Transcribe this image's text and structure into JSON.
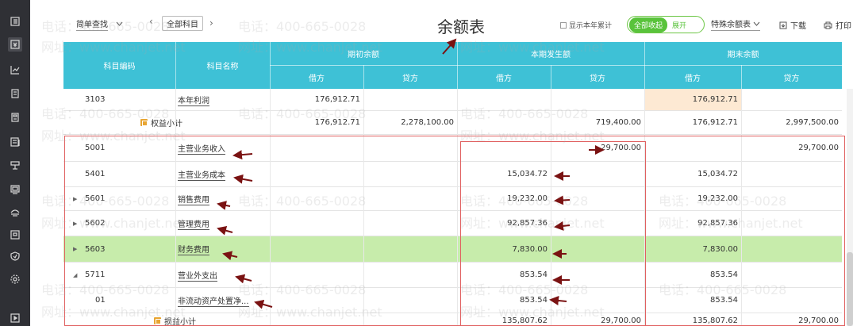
{
  "toolbar": {
    "query_mode": "简单查找",
    "all_accounts": "全部科目",
    "title": "余额表",
    "show_year_label": "显示本年累计",
    "collapse_all": "全部收起",
    "expand": "展开",
    "special_balance": "特殊余额表",
    "download": "下载",
    "print": "打印"
  },
  "header": {
    "code": "科目编码",
    "name": "科目名称",
    "opening": "期初余额",
    "current": "本期发生额",
    "closing": "期末余额",
    "debit": "借方",
    "credit": "贷方"
  },
  "watermark": {
    "phone": "电话：400-665-0028",
    "site": "网址：www.chanjet.net"
  },
  "rows": [
    {
      "code": "3103",
      "name": "本年利润",
      "open_dr": "176,912.71",
      "open_cr": "",
      "cur_dr": "",
      "cur_cr": "",
      "close_dr": "176,912.71",
      "close_cr": ""
    },
    {
      "code": "",
      "name": "权益小计",
      "open_dr": "176,912.71",
      "open_cr": "2,278,100.00",
      "cur_dr": "",
      "cur_cr": "719,400.00",
      "close_dr": "176,912.71",
      "close_cr": "2,997,500.00"
    },
    {
      "code": "5001",
      "name": "主营业务收入",
      "open_dr": "",
      "open_cr": "",
      "cur_dr": "",
      "cur_cr": "29,700.00",
      "close_dr": "",
      "close_cr": "29,700.00"
    },
    {
      "code": "5401",
      "name": "主营业务成本",
      "open_dr": "",
      "open_cr": "",
      "cur_dr": "15,034.72",
      "cur_cr": "",
      "close_dr": "15,034.72",
      "close_cr": ""
    },
    {
      "code": "5601",
      "name": "销售费用",
      "open_dr": "",
      "open_cr": "",
      "cur_dr": "19,232.00",
      "cur_cr": "",
      "close_dr": "19,232.00",
      "close_cr": ""
    },
    {
      "code": "5602",
      "name": "管理费用",
      "open_dr": "",
      "open_cr": "",
      "cur_dr": "92,857.36",
      "cur_cr": "",
      "close_dr": "92,857.36",
      "close_cr": ""
    },
    {
      "code": "5603",
      "name": "财务费用",
      "open_dr": "",
      "open_cr": "",
      "cur_dr": "7,830.00",
      "cur_cr": "",
      "close_dr": "7,830.00",
      "close_cr": ""
    },
    {
      "code": "5711",
      "name": "营业外支出",
      "open_dr": "",
      "open_cr": "",
      "cur_dr": "853.54",
      "cur_cr": "",
      "close_dr": "853.54",
      "close_cr": ""
    },
    {
      "code": "01",
      "name": "非流动资产处置净...",
      "open_dr": "",
      "open_cr": "",
      "cur_dr": "853.54",
      "cur_cr": "",
      "close_dr": "853.54",
      "close_cr": ""
    },
    {
      "code": "",
      "name": "损益小计",
      "open_dr": "",
      "open_cr": "",
      "cur_dr": "135,807.62",
      "cur_cr": "29,700.00",
      "close_dr": "135,807.62",
      "close_cr": "29,700.00"
    }
  ]
}
